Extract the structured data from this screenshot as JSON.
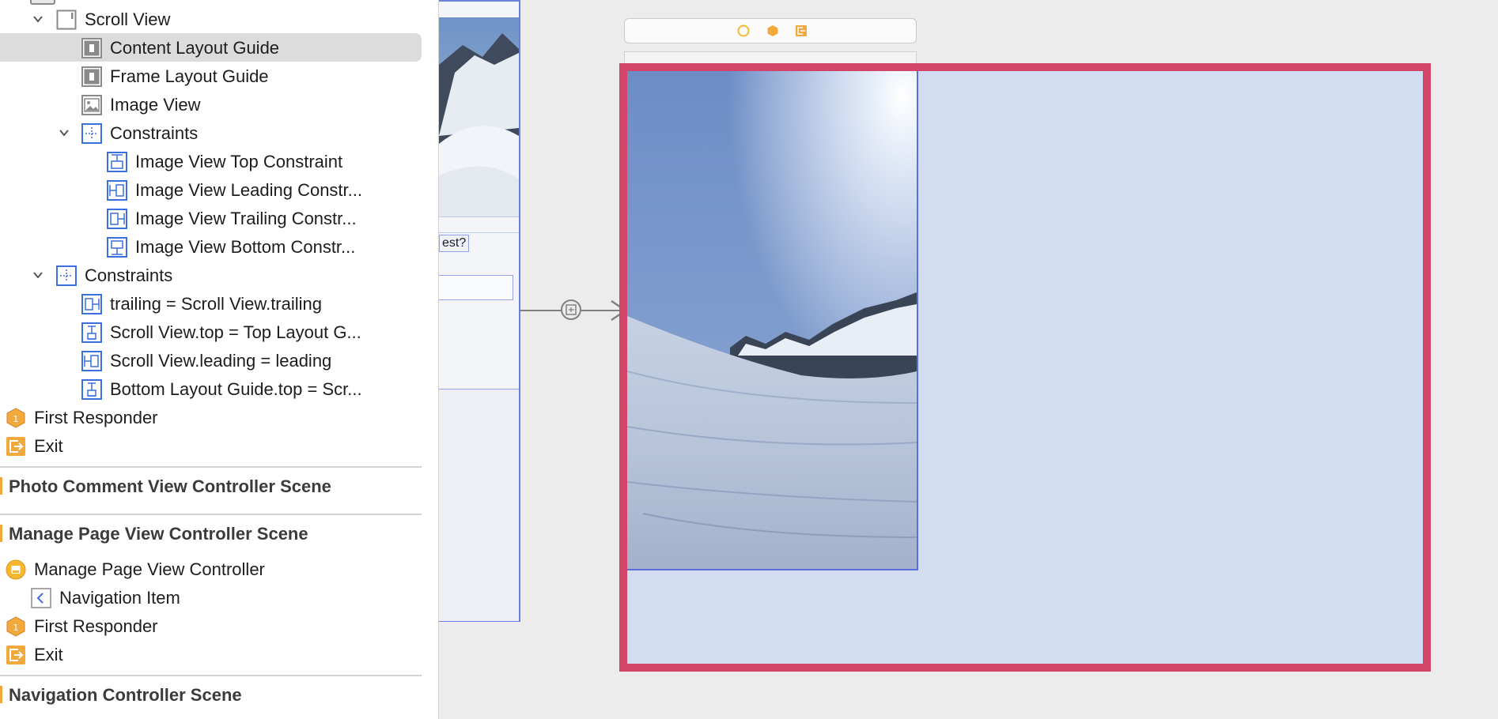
{
  "outline": {
    "rows": [
      {
        "label": "Scroll View",
        "icon": "scroll-view-icon",
        "expanded": true
      },
      {
        "label": "Content Layout Guide",
        "icon": "layout-guide-icon",
        "selected": true
      },
      {
        "label": "Frame Layout Guide",
        "icon": "layout-guide-icon"
      },
      {
        "label": "Image View",
        "icon": "image-view-icon"
      },
      {
        "label": "Constraints",
        "icon": "constraints-icon",
        "expanded": true
      },
      {
        "label": "Image View Top Constraint",
        "icon": "top-constraint-icon"
      },
      {
        "label": "Image View Leading Constr...",
        "icon": "leading-constraint-icon"
      },
      {
        "label": "Image View Trailing Constr...",
        "icon": "trailing-constraint-icon"
      },
      {
        "label": "Image View Bottom Constr...",
        "icon": "bottom-constraint-icon"
      },
      {
        "label": "Constraints",
        "icon": "constraints-icon",
        "expanded": true
      },
      {
        "label": "trailing = Scroll View.trailing",
        "icon": "trailing-constraint-icon"
      },
      {
        "label": "Scroll View.top = Top Layout G...",
        "icon": "vertical-constraint-icon"
      },
      {
        "label": "Scroll View.leading = leading",
        "icon": "leading-constraint-icon"
      },
      {
        "label": "Bottom Layout Guide.top = Scr...",
        "icon": "vertical-constraint-icon"
      },
      {
        "label": "First Responder",
        "icon": "first-responder-icon"
      },
      {
        "label": "Exit",
        "icon": "exit-icon"
      }
    ],
    "scenes": [
      {
        "title": "Photo Comment View Controller Scene"
      },
      {
        "title": "Manage Page View Controller Scene",
        "rows": [
          {
            "label": "Manage Page View Controller",
            "icon": "view-controller-icon"
          },
          {
            "label": "Navigation Item",
            "icon": "navigation-item-icon"
          },
          {
            "label": "First Responder",
            "icon": "first-responder-icon"
          },
          {
            "label": "Exit",
            "icon": "exit-icon"
          }
        ]
      },
      {
        "title": "Navigation Controller Scene"
      }
    ]
  },
  "canvas": {
    "previous_scene_label": "est?",
    "dock_icons": [
      "view-controller-icon",
      "first-responder-icon",
      "exit-icon"
    ]
  },
  "colors": {
    "selection_border": "#d34568",
    "constraint_blue": "#3b6fe0",
    "scene_background": "#d2ddf1",
    "accent_orange": "#f0a93a"
  }
}
